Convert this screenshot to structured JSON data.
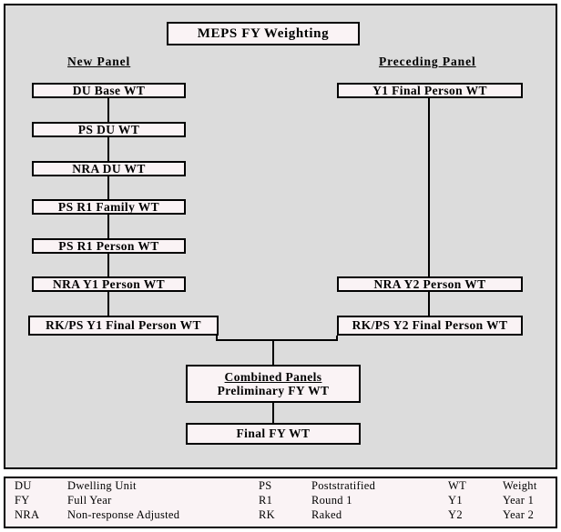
{
  "title_box": {
    "label": "MEPS FY Weighting"
  },
  "headings": {
    "left": "New Panel",
    "right": "Preceding Panel"
  },
  "left_column": [
    {
      "label": "DU Base WT"
    },
    {
      "label": "PS DU WT"
    },
    {
      "label": "NRA DU WT"
    },
    {
      "label": "PS R1 Family WT"
    },
    {
      "label": "PS R1 Person WT"
    },
    {
      "label": "NRA Y1 Person WT"
    },
    {
      "label": "RK/PS Y1 Final Person WT"
    }
  ],
  "right_column": [
    {
      "label": "Y1 Final Person WT"
    },
    {
      "label": "NRA Y2 Person WT"
    },
    {
      "label": "RK/PS Y2 Final Person WT"
    }
  ],
  "combined_box": {
    "line1": "Combined Panels",
    "line2": "Preliminary FY WT"
  },
  "final_box": {
    "label": "Final FY WT"
  },
  "legend": {
    "rows": [
      {
        "abbr1": "DU",
        "term1": "Dwelling Unit",
        "abbr2": "PS",
        "term2": "Poststratified",
        "abbr3": "WT",
        "term3": "Weight"
      },
      {
        "abbr1": "FY",
        "term1": "Full Year",
        "abbr2": "R1",
        "term2": "Round 1",
        "abbr3": "Y1",
        "term3": "Year 1"
      },
      {
        "abbr1": "NRA",
        "term1": "Non-response Adjusted",
        "abbr2": "RK",
        "term2": "Raked",
        "abbr3": "Y2",
        "term3": "Year 2"
      }
    ]
  },
  "colors": {
    "panel_background": "#dcdcdc",
    "node_fill": "#faf3f5",
    "border": "#000000",
    "text": "#000000"
  }
}
